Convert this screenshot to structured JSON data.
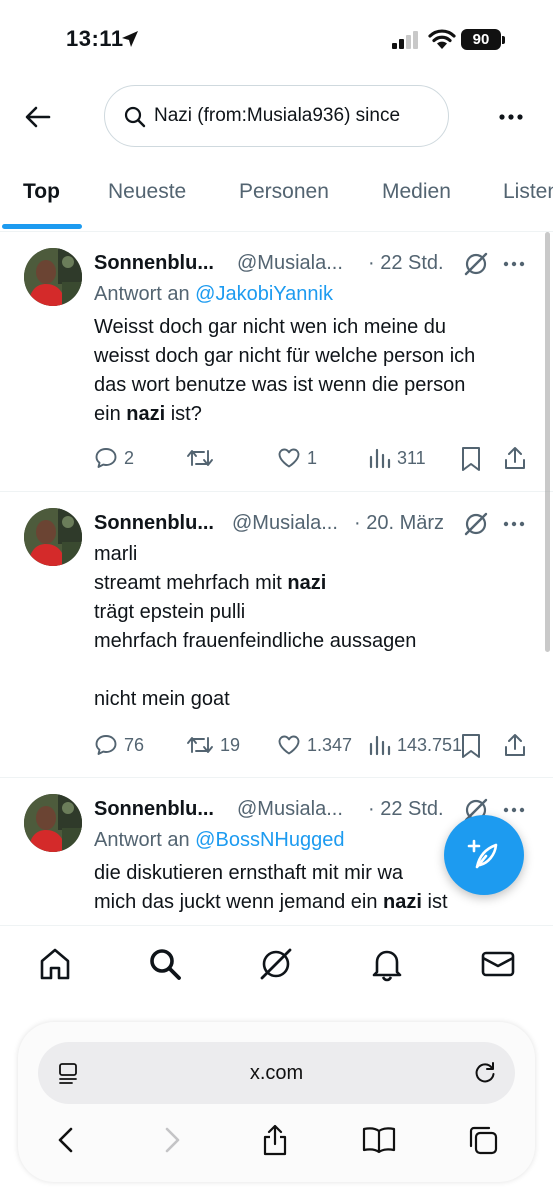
{
  "status_bar": {
    "time": "13:11",
    "battery": "90"
  },
  "search": {
    "query": "Nazi (from:Musiala936) since"
  },
  "tabs": [
    {
      "label": "Top",
      "active": true
    },
    {
      "label": "Neueste",
      "active": false
    },
    {
      "label": "Personen",
      "active": false
    },
    {
      "label": "Medien",
      "active": false
    },
    {
      "label": "Listen",
      "active": false
    }
  ],
  "tweets": [
    {
      "name": "Sonnenblu...",
      "handle": "@Musiala...",
      "time": "· 22 Std.",
      "reply_prefix": "Antwort an ",
      "reply_to": "@JakobiYannik",
      "lines": [
        {
          "pre": "Weisst doch gar nicht wen ich meine du",
          "bold": "",
          "post": ""
        },
        {
          "pre": "weisst doch gar nicht für welche person ich",
          "bold": "",
          "post": ""
        },
        {
          "pre": "das wort benutze was ist wenn die person",
          "bold": "",
          "post": ""
        },
        {
          "pre": "ein ",
          "bold": "nazi",
          "post": " ist?"
        }
      ],
      "replies": "2",
      "retweets": "",
      "likes": "1",
      "views": "311"
    },
    {
      "name": "Sonnenblu...",
      "handle": "@Musiala...",
      "time": "· 20. März",
      "reply_prefix": "",
      "reply_to": "",
      "lines": [
        {
          "pre": "marli",
          "bold": "",
          "post": ""
        },
        {
          "pre": "streamt mehrfach mit ",
          "bold": "nazi",
          "post": ""
        },
        {
          "pre": "trägt epstein pulli",
          "bold": "",
          "post": ""
        },
        {
          "pre": "mehrfach frauenfeindliche aussagen",
          "bold": "",
          "post": ""
        },
        {
          "pre": "",
          "bold": "",
          "post": ""
        },
        {
          "pre": "nicht mein goat",
          "bold": "",
          "post": ""
        }
      ],
      "replies": "76",
      "retweets": "19",
      "likes": "1.347",
      "views": "143.751"
    },
    {
      "name": "Sonnenblu...",
      "handle": "@Musiala...",
      "time": "· 22 Std.",
      "reply_prefix": "Antwort an ",
      "reply_to": "@BossNHugged",
      "lines": [
        {
          "pre": "die diskutieren ernsthaft mit mir wa",
          "bold": "",
          "post": ""
        },
        {
          "pre": "mich das juckt wenn jemand ein ",
          "bold": "nazi",
          "post": " ist"
        }
      ]
    }
  ],
  "bottom_nav": [
    "home-icon",
    "search-icon",
    "grok-icon",
    "bell-icon",
    "mail-icon"
  ],
  "browser": {
    "url": "x.com"
  },
  "colors": {
    "accent": "#1d9bf0",
    "text": "#0f1419",
    "secondary": "#536471"
  }
}
